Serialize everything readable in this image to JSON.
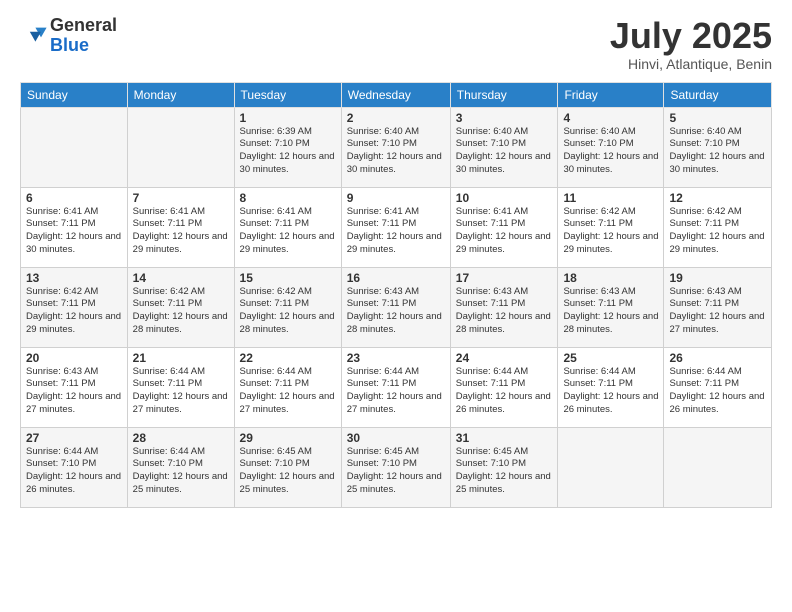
{
  "logo": {
    "general": "General",
    "blue": "Blue"
  },
  "header": {
    "month": "July 2025",
    "location": "Hinvi, Atlantique, Benin"
  },
  "weekdays": [
    "Sunday",
    "Monday",
    "Tuesday",
    "Wednesday",
    "Thursday",
    "Friday",
    "Saturday"
  ],
  "weeks": [
    [
      {
        "day": "",
        "sunrise": "",
        "sunset": "",
        "daylight": ""
      },
      {
        "day": "",
        "sunrise": "",
        "sunset": "",
        "daylight": ""
      },
      {
        "day": "1",
        "sunrise": "Sunrise: 6:39 AM",
        "sunset": "Sunset: 7:10 PM",
        "daylight": "Daylight: 12 hours and 30 minutes."
      },
      {
        "day": "2",
        "sunrise": "Sunrise: 6:40 AM",
        "sunset": "Sunset: 7:10 PM",
        "daylight": "Daylight: 12 hours and 30 minutes."
      },
      {
        "day": "3",
        "sunrise": "Sunrise: 6:40 AM",
        "sunset": "Sunset: 7:10 PM",
        "daylight": "Daylight: 12 hours and 30 minutes."
      },
      {
        "day": "4",
        "sunrise": "Sunrise: 6:40 AM",
        "sunset": "Sunset: 7:10 PM",
        "daylight": "Daylight: 12 hours and 30 minutes."
      },
      {
        "day": "5",
        "sunrise": "Sunrise: 6:40 AM",
        "sunset": "Sunset: 7:10 PM",
        "daylight": "Daylight: 12 hours and 30 minutes."
      }
    ],
    [
      {
        "day": "6",
        "sunrise": "Sunrise: 6:41 AM",
        "sunset": "Sunset: 7:11 PM",
        "daylight": "Daylight: 12 hours and 30 minutes."
      },
      {
        "day": "7",
        "sunrise": "Sunrise: 6:41 AM",
        "sunset": "Sunset: 7:11 PM",
        "daylight": "Daylight: 12 hours and 29 minutes."
      },
      {
        "day": "8",
        "sunrise": "Sunrise: 6:41 AM",
        "sunset": "Sunset: 7:11 PM",
        "daylight": "Daylight: 12 hours and 29 minutes."
      },
      {
        "day": "9",
        "sunrise": "Sunrise: 6:41 AM",
        "sunset": "Sunset: 7:11 PM",
        "daylight": "Daylight: 12 hours and 29 minutes."
      },
      {
        "day": "10",
        "sunrise": "Sunrise: 6:41 AM",
        "sunset": "Sunset: 7:11 PM",
        "daylight": "Daylight: 12 hours and 29 minutes."
      },
      {
        "day": "11",
        "sunrise": "Sunrise: 6:42 AM",
        "sunset": "Sunset: 7:11 PM",
        "daylight": "Daylight: 12 hours and 29 minutes."
      },
      {
        "day": "12",
        "sunrise": "Sunrise: 6:42 AM",
        "sunset": "Sunset: 7:11 PM",
        "daylight": "Daylight: 12 hours and 29 minutes."
      }
    ],
    [
      {
        "day": "13",
        "sunrise": "Sunrise: 6:42 AM",
        "sunset": "Sunset: 7:11 PM",
        "daylight": "Daylight: 12 hours and 29 minutes."
      },
      {
        "day": "14",
        "sunrise": "Sunrise: 6:42 AM",
        "sunset": "Sunset: 7:11 PM",
        "daylight": "Daylight: 12 hours and 28 minutes."
      },
      {
        "day": "15",
        "sunrise": "Sunrise: 6:42 AM",
        "sunset": "Sunset: 7:11 PM",
        "daylight": "Daylight: 12 hours and 28 minutes."
      },
      {
        "day": "16",
        "sunrise": "Sunrise: 6:43 AM",
        "sunset": "Sunset: 7:11 PM",
        "daylight": "Daylight: 12 hours and 28 minutes."
      },
      {
        "day": "17",
        "sunrise": "Sunrise: 6:43 AM",
        "sunset": "Sunset: 7:11 PM",
        "daylight": "Daylight: 12 hours and 28 minutes."
      },
      {
        "day": "18",
        "sunrise": "Sunrise: 6:43 AM",
        "sunset": "Sunset: 7:11 PM",
        "daylight": "Daylight: 12 hours and 28 minutes."
      },
      {
        "day": "19",
        "sunrise": "Sunrise: 6:43 AM",
        "sunset": "Sunset: 7:11 PM",
        "daylight": "Daylight: 12 hours and 27 minutes."
      }
    ],
    [
      {
        "day": "20",
        "sunrise": "Sunrise: 6:43 AM",
        "sunset": "Sunset: 7:11 PM",
        "daylight": "Daylight: 12 hours and 27 minutes."
      },
      {
        "day": "21",
        "sunrise": "Sunrise: 6:44 AM",
        "sunset": "Sunset: 7:11 PM",
        "daylight": "Daylight: 12 hours and 27 minutes."
      },
      {
        "day": "22",
        "sunrise": "Sunrise: 6:44 AM",
        "sunset": "Sunset: 7:11 PM",
        "daylight": "Daylight: 12 hours and 27 minutes."
      },
      {
        "day": "23",
        "sunrise": "Sunrise: 6:44 AM",
        "sunset": "Sunset: 7:11 PM",
        "daylight": "Daylight: 12 hours and 27 minutes."
      },
      {
        "day": "24",
        "sunrise": "Sunrise: 6:44 AM",
        "sunset": "Sunset: 7:11 PM",
        "daylight": "Daylight: 12 hours and 26 minutes."
      },
      {
        "day": "25",
        "sunrise": "Sunrise: 6:44 AM",
        "sunset": "Sunset: 7:11 PM",
        "daylight": "Daylight: 12 hours and 26 minutes."
      },
      {
        "day": "26",
        "sunrise": "Sunrise: 6:44 AM",
        "sunset": "Sunset: 7:11 PM",
        "daylight": "Daylight: 12 hours and 26 minutes."
      }
    ],
    [
      {
        "day": "27",
        "sunrise": "Sunrise: 6:44 AM",
        "sunset": "Sunset: 7:10 PM",
        "daylight": "Daylight: 12 hours and 26 minutes."
      },
      {
        "day": "28",
        "sunrise": "Sunrise: 6:44 AM",
        "sunset": "Sunset: 7:10 PM",
        "daylight": "Daylight: 12 hours and 25 minutes."
      },
      {
        "day": "29",
        "sunrise": "Sunrise: 6:45 AM",
        "sunset": "Sunset: 7:10 PM",
        "daylight": "Daylight: 12 hours and 25 minutes."
      },
      {
        "day": "30",
        "sunrise": "Sunrise: 6:45 AM",
        "sunset": "Sunset: 7:10 PM",
        "daylight": "Daylight: 12 hours and 25 minutes."
      },
      {
        "day": "31",
        "sunrise": "Sunrise: 6:45 AM",
        "sunset": "Sunset: 7:10 PM",
        "daylight": "Daylight: 12 hours and 25 minutes."
      },
      {
        "day": "",
        "sunrise": "",
        "sunset": "",
        "daylight": ""
      },
      {
        "day": "",
        "sunrise": "",
        "sunset": "",
        "daylight": ""
      }
    ]
  ]
}
